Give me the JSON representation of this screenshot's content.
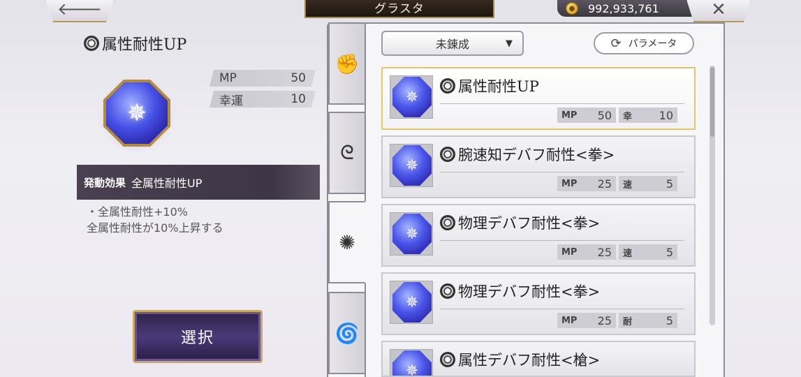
{
  "header": {
    "back_icon": "back-arrow-icon",
    "title": "グラスタ",
    "coins": "992,933,761",
    "close_icon": "close-icon"
  },
  "detail": {
    "title": "属性耐性UP",
    "stats": [
      {
        "key": "MP",
        "value": "50"
      },
      {
        "key": "幸運",
        "value": "10"
      }
    ],
    "effect_label": "発動効果",
    "effect_value": "全属性耐性UP",
    "desc_line1": "・全属性耐性+10%",
    "desc_line2": "全属性耐性が10%上昇する",
    "select_label": "選択"
  },
  "tabs": [
    {
      "name": "fist-icon",
      "glyph": "✊"
    },
    {
      "name": "swirl-icon",
      "glyph": "ᘓ"
    },
    {
      "name": "seal-icon",
      "glyph": "✺"
    },
    {
      "name": "spiral-icon",
      "glyph": "🌀"
    }
  ],
  "list": {
    "filter_value": "未錬成",
    "param_label": "パラメータ",
    "items": [
      {
        "name": "属性耐性UP",
        "stats": [
          {
            "k": "MP",
            "v": "50"
          },
          {
            "k": "幸",
            "v": "10"
          }
        ]
      },
      {
        "name": "腕速知デバフ耐性<拳>",
        "stats": [
          {
            "k": "MP",
            "v": "25"
          },
          {
            "k": "速",
            "v": "5"
          }
        ]
      },
      {
        "name": "物理デバフ耐性<拳>",
        "stats": [
          {
            "k": "MP",
            "v": "25"
          },
          {
            "k": "速",
            "v": "5"
          }
        ]
      },
      {
        "name": "物理デバフ耐性<拳>",
        "stats": [
          {
            "k": "MP",
            "v": "25"
          },
          {
            "k": "耐",
            "v": "5"
          }
        ]
      },
      {
        "name": "属性デバフ耐性<槍>"
      }
    ]
  }
}
